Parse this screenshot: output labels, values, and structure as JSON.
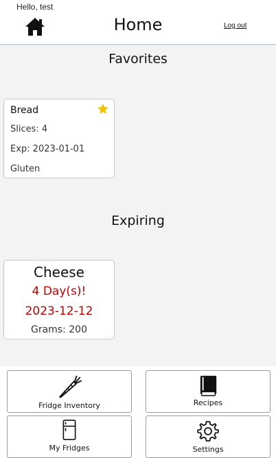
{
  "header": {
    "greeting": "Hello, test",
    "title": "Home",
    "logout_label": "Log out",
    "home_icon": "home-icon"
  },
  "favorites": {
    "title": "Favorites",
    "items": [
      {
        "name": "Bread",
        "line2": "Slices: 4",
        "line3": "Exp: 2023-01-01",
        "line4": "Gluten",
        "favorite": true,
        "star_color": "#f2c200"
      }
    ]
  },
  "expiring": {
    "title": "Expiring",
    "items": [
      {
        "name": "Cheese",
        "days": "4 Day(s)!",
        "date": "2023-12-12",
        "quantity": "Grams: 200",
        "alert_color": "#c00000"
      }
    ]
  },
  "nav": {
    "fridge_inventory": {
      "label": "Fridge Inventory",
      "icon": "carrot-icon"
    },
    "recipes": {
      "label": "Recipes",
      "icon": "book-icon"
    },
    "my_fridges": {
      "label": "My Fridges",
      "icon": "fridge-icon"
    },
    "settings": {
      "label": "Settings",
      "icon": "gear-icon"
    }
  }
}
